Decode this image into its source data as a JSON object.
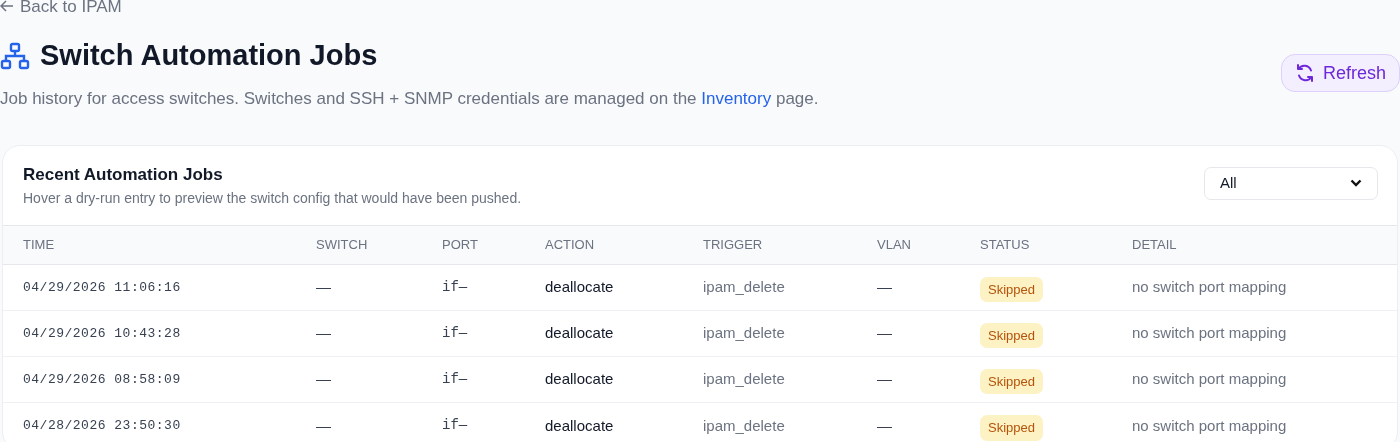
{
  "back_link": "Back to IPAM",
  "title": "Switch Automation Jobs",
  "description": {
    "before": "Job history for access switches. Switches and SSH + SNMP credentials are managed on the ",
    "link": "Inventory",
    "after": " page."
  },
  "refresh_button": "Refresh",
  "card": {
    "title": "Recent Automation Jobs",
    "subtitle": "Hover a dry-run entry to preview the switch config that would have been pushed.",
    "filter": {
      "value": "All"
    }
  },
  "table": {
    "columns": [
      "TIME",
      "SWITCH",
      "PORT",
      "ACTION",
      "TRIGGER",
      "VLAN",
      "STATUS",
      "DETAIL"
    ],
    "rows": [
      {
        "time": "04/29/2026 11:06:16",
        "switch": "—",
        "port": "if—",
        "action": "deallocate",
        "trigger": "ipam_delete",
        "vlan": "—",
        "status": {
          "label": "Skipped",
          "kind": "skipped"
        },
        "detail": "no switch port mapping"
      },
      {
        "time": "04/29/2026 10:43:28",
        "switch": "—",
        "port": "if—",
        "action": "deallocate",
        "trigger": "ipam_delete",
        "vlan": "—",
        "status": {
          "label": "Skipped",
          "kind": "skipped"
        },
        "detail": "no switch port mapping"
      },
      {
        "time": "04/29/2026 08:58:09",
        "switch": "—",
        "port": "if—",
        "action": "deallocate",
        "trigger": "ipam_delete",
        "vlan": "—",
        "status": {
          "label": "Skipped",
          "kind": "skipped"
        },
        "detail": "no switch port mapping"
      },
      {
        "time": "04/28/2026 23:50:30",
        "switch": "—",
        "port": "if—",
        "action": "deallocate",
        "trigger": "ipam_delete",
        "vlan": "—",
        "status": {
          "label": "Skipped",
          "kind": "skipped"
        },
        "detail": "no switch port mapping"
      }
    ]
  }
}
